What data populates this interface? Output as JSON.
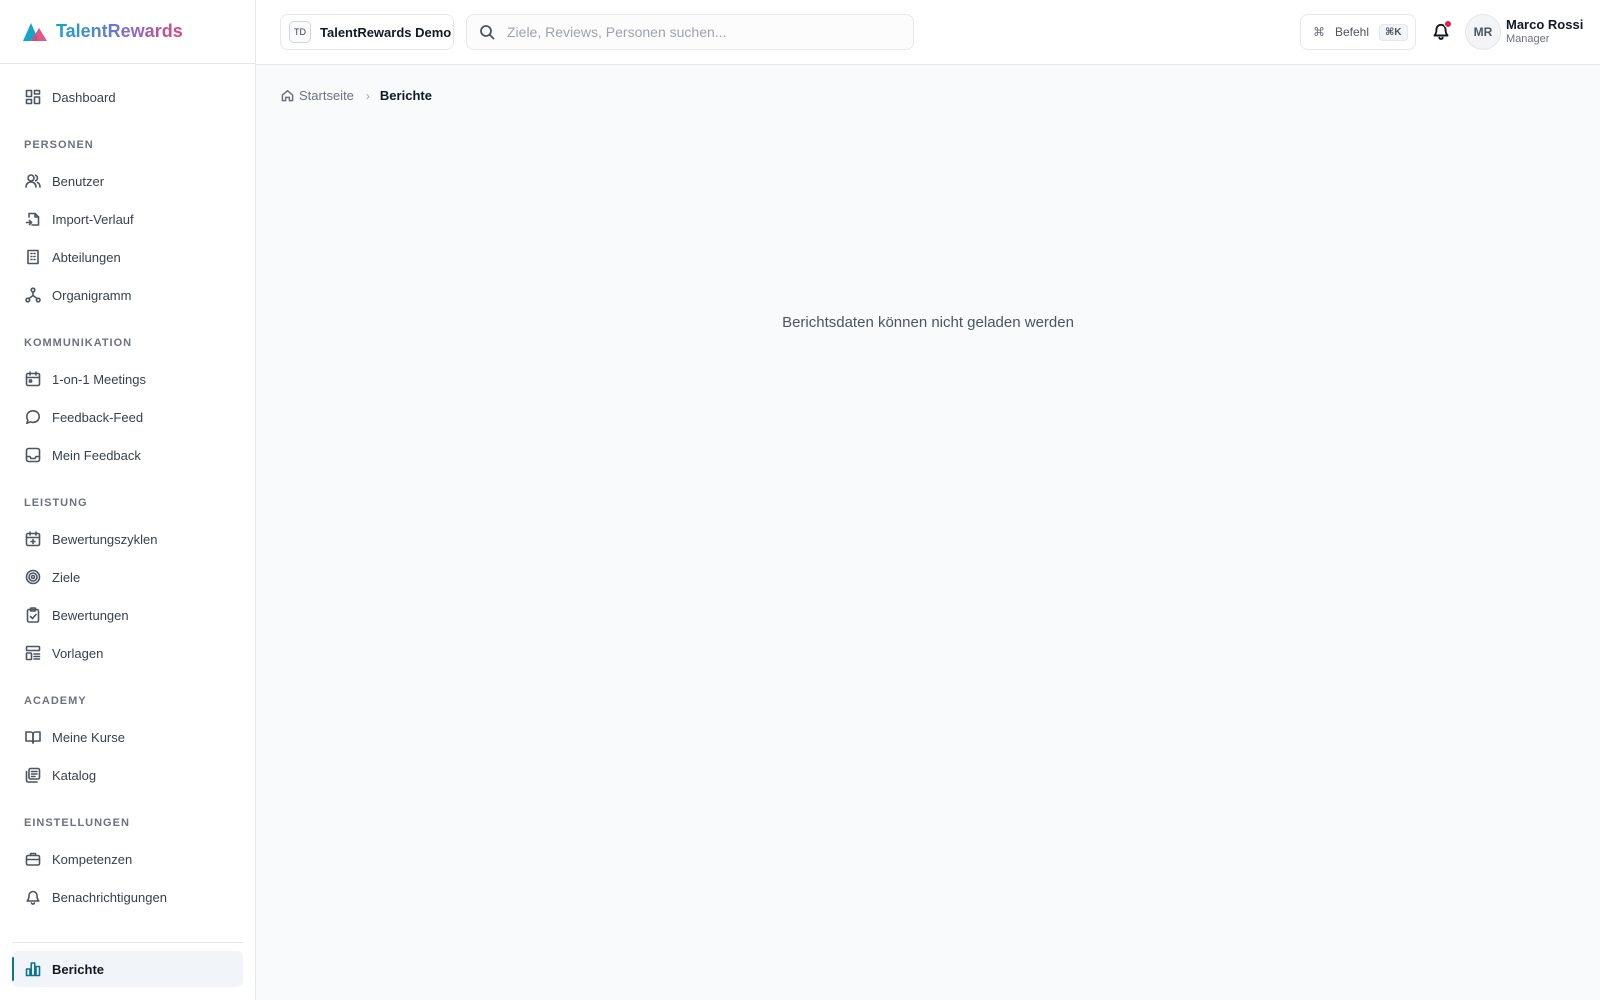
{
  "brand": {
    "name": "TalentRewards"
  },
  "sidebar": {
    "top": [
      {
        "label": "Dashboard",
        "icon": "dashboard-icon"
      }
    ],
    "sections": [
      {
        "title": "PERSONEN",
        "items": [
          {
            "label": "Benutzer",
            "icon": "users-icon"
          },
          {
            "label": "Import-Verlauf",
            "icon": "file-import-icon"
          },
          {
            "label": "Abteilungen",
            "icon": "building-icon"
          },
          {
            "label": "Organigramm",
            "icon": "org-chart-icon"
          }
        ]
      },
      {
        "title": "KOMMUNIKATION",
        "items": [
          {
            "label": "1-on-1 Meetings",
            "icon": "calendar-icon"
          },
          {
            "label": "Feedback-Feed",
            "icon": "chat-bubble-icon"
          },
          {
            "label": "Mein Feedback",
            "icon": "inbox-icon"
          }
        ]
      },
      {
        "title": "LEISTUNG",
        "items": [
          {
            "label": "Bewertungszyklen",
            "icon": "calendar-cycle-icon"
          },
          {
            "label": "Ziele",
            "icon": "target-icon"
          },
          {
            "label": "Bewertungen",
            "icon": "clipboard-check-icon"
          },
          {
            "label": "Vorlagen",
            "icon": "template-icon"
          }
        ]
      },
      {
        "title": "ACADEMY",
        "items": [
          {
            "label": "Meine Kurse",
            "icon": "book-open-icon"
          },
          {
            "label": "Katalog",
            "icon": "library-icon"
          }
        ]
      },
      {
        "title": "EINSTELLUNGEN",
        "items": [
          {
            "label": "Kompetenzen",
            "icon": "briefcase-icon"
          },
          {
            "label": "Benachrichtigungen",
            "icon": "bell-icon"
          }
        ]
      }
    ],
    "active": {
      "label": "Berichte",
      "icon": "bar-chart-icon"
    }
  },
  "header": {
    "tenant_badge": "TD",
    "tenant_name": "TalentRewards Demo",
    "search_placeholder": "Ziele, Reviews, Personen suchen...",
    "command_label": "Befehl",
    "command_shortcut": "⌘K",
    "avatar_initials": "MR",
    "user_name": "Marco Rossi",
    "user_role": "Manager"
  },
  "breadcrumb": {
    "home": "Startseite",
    "current": "Berichte"
  },
  "main": {
    "message": "Berichtsdaten können nicht geladen werden"
  },
  "colors": {
    "accent": "#0e7490",
    "notification": "#e11d48"
  }
}
